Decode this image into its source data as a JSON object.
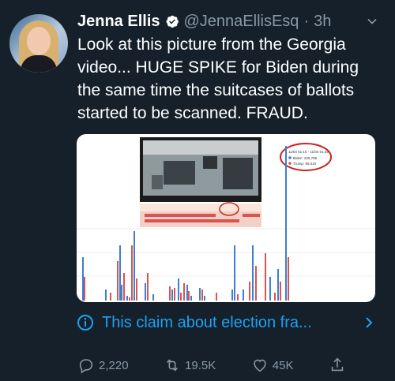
{
  "tweet": {
    "author_name": "Jenna Ellis",
    "handle": "@JennaEllisEsq",
    "separator": "·",
    "time": "3h",
    "lines": [
      "Look at this picture from the Georgia",
      "video... HUGE SPIKE for Biden during",
      "the same time the suitcases of ballots",
      "started to be scanned. FRAUD."
    ]
  },
  "media": {
    "legend_lines": [
      "11/04 01:10 - 11/04 01:35",
      "Biden: 225,785",
      "Trump: 90,010"
    ],
    "colors": {
      "biden": "#3c7fd1",
      "trump": "#d9534f",
      "spike_circle": "#cc2222"
    }
  },
  "claim": {
    "text": "This claim about election fra...",
    "icon": "info-circle-icon"
  },
  "actions": {
    "replies": "2,220",
    "retweets": "19.5K",
    "likes": "45K"
  },
  "colors": {
    "background": "#15202b",
    "accent": "#1da1f2",
    "muted": "#8899a6"
  }
}
